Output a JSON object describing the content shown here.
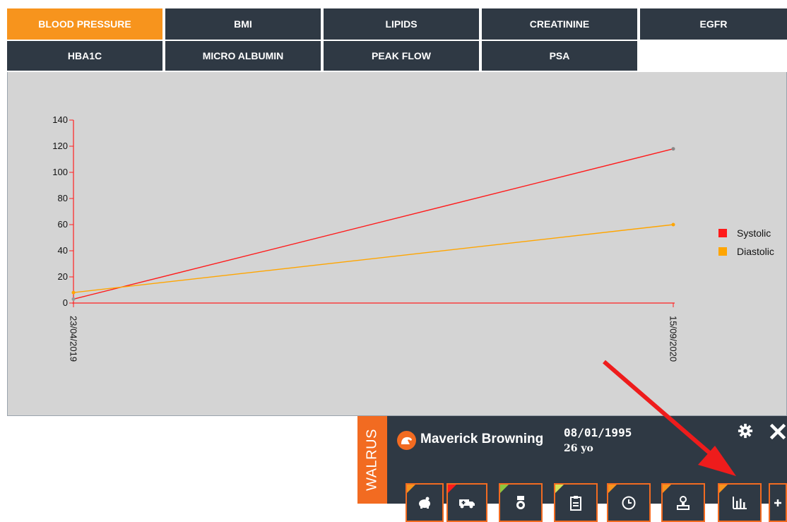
{
  "tabs": {
    "row1": [
      {
        "label": "BLOOD PRESSURE",
        "active": true
      },
      {
        "label": "BMI",
        "active": false
      },
      {
        "label": "LIPIDS",
        "active": false
      },
      {
        "label": "CREATININE",
        "active": false
      },
      {
        "label": "EGFR",
        "active": false
      }
    ],
    "row2": [
      {
        "label": "HBA1C",
        "active": false
      },
      {
        "label": "MICRO ALBUMIN",
        "active": false
      },
      {
        "label": "PEAK FLOW",
        "active": false
      },
      {
        "label": "PSA",
        "active": false
      }
    ]
  },
  "colors": {
    "tab_bg": "#2f3944",
    "tab_active": "#f7941d",
    "plot_bg": "#d4d4d4",
    "axis": "#ff2020",
    "systolic": "#ff1a1a",
    "diastolic": "#ffa500",
    "widget_bg": "#2f3944",
    "walrus_orange": "#f26b21"
  },
  "chart_data": {
    "type": "line",
    "x": [
      "23/04/2019",
      "15/09/2020"
    ],
    "series": [
      {
        "name": "Systolic",
        "values": [
          3,
          118
        ],
        "color": "#ff1a1a"
      },
      {
        "name": "Diastolic",
        "values": [
          8,
          60
        ],
        "color": "#ffa500"
      }
    ],
    "yticks": [
      0,
      20,
      40,
      60,
      80,
      100,
      120,
      140
    ],
    "ylim": [
      0,
      140
    ],
    "legend": "right",
    "grid": false
  },
  "widget": {
    "brand": "WALRUS",
    "patient_name": "Maverick Browning",
    "dob": "08/01/1995",
    "age": "26 yo",
    "logo_icon": "walrus-logo-icon",
    "settings_icon": "gear-icon",
    "close_icon": "close-icon",
    "toolbar": [
      {
        "icon": "piggy-bank-icon",
        "marker": "#f7941d"
      },
      {
        "icon": "ambulance-icon",
        "marker": "#ff1a1a"
      },
      {
        "icon": "medal-icon",
        "marker": "#8cc63f"
      },
      {
        "icon": "clipboard-icon",
        "marker": "#d4e157"
      },
      {
        "icon": "clock-icon",
        "marker": "#f7941d"
      },
      {
        "icon": "stamp-icon",
        "marker": "#f7941d"
      },
      {
        "icon": "bar-chart-icon",
        "marker": "#f7941d"
      },
      {
        "icon": "plus-icon",
        "marker": "none"
      }
    ]
  }
}
